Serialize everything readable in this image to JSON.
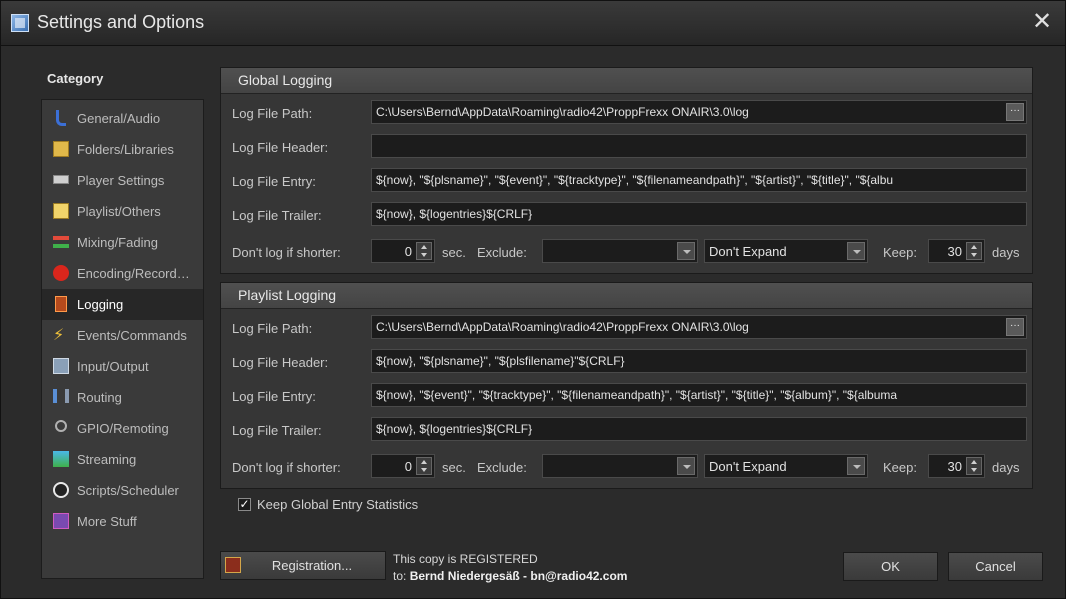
{
  "window": {
    "title": "Settings and Options",
    "close_glyph": "✕"
  },
  "sidebar": {
    "heading": "Category",
    "items": [
      {
        "label": "General/Audio",
        "icon": "music-note-icon"
      },
      {
        "label": "Folders/Libraries",
        "icon": "folder-icon"
      },
      {
        "label": "Player Settings",
        "icon": "player-icon"
      },
      {
        "label": "Playlist/Others",
        "icon": "playlist-icon"
      },
      {
        "label": "Mixing/Fading",
        "icon": "mixing-icon"
      },
      {
        "label": "Encoding/Record…",
        "icon": "record-icon"
      },
      {
        "label": "Logging",
        "icon": "log-book-icon",
        "active": true
      },
      {
        "label": "Events/Commands",
        "icon": "lightning-icon"
      },
      {
        "label": "Input/Output",
        "icon": "input-output-icon"
      },
      {
        "label": "Routing",
        "icon": "routing-icon"
      },
      {
        "label": "GPIO/Remoting",
        "icon": "gpio-icon"
      },
      {
        "label": "Streaming",
        "icon": "streaming-icon"
      },
      {
        "label": "Scripts/Scheduler",
        "icon": "clock-icon"
      },
      {
        "label": "More Stuff",
        "icon": "more-stuff-icon"
      }
    ]
  },
  "global_logging": {
    "title": "Global Logging",
    "path_label": "Log File Path:",
    "path_value": "C:\\Users\\Bernd\\AppData\\Roaming\\radio42\\ProppFrexx ONAIR\\3.0\\log",
    "browse_label": "···",
    "header_label": "Log File Header:",
    "header_value": "",
    "entry_label": "Log File Entry:",
    "entry_value": "${now}, \"${plsname}\", \"${event}\", \"${tracktype}\", \"${filenameandpath}\", \"${artist}\", \"${title}\", \"${albu",
    "trailer_label": "Log File Trailer:",
    "trailer_value": "${now}, ${logentries}${CRLF}",
    "shorter_label": "Don't log if shorter:",
    "shorter_value": "0",
    "sec_label": "sec.",
    "exclude_label": "Exclude:",
    "exclude_value": "",
    "expand_value": "Don't Expand",
    "keep_label": "Keep:",
    "keep_value": "30",
    "days_label": "days"
  },
  "playlist_logging": {
    "title": "Playlist Logging",
    "path_label": "Log File Path:",
    "path_value": "C:\\Users\\Bernd\\AppData\\Roaming\\radio42\\ProppFrexx ONAIR\\3.0\\log",
    "browse_label": "···",
    "header_label": "Log File Header:",
    "header_value": "${now}, \"${plsname}\", \"${plsfilename}\"${CRLF}",
    "entry_label": "Log File Entry:",
    "entry_value": "${now}, \"${event}\", \"${tracktype}\", \"${filenameandpath}\", \"${artist}\", \"${title}\", \"${album}\", \"${albuma",
    "trailer_label": "Log File Trailer:",
    "trailer_value": "${now}, ${logentries}${CRLF}",
    "shorter_label": "Don't log if shorter:",
    "shorter_value": "0",
    "sec_label": "sec.",
    "exclude_label": "Exclude:",
    "exclude_value": "",
    "expand_value": "Don't Expand",
    "keep_label": "Keep:",
    "keep_value": "30",
    "days_label": "days"
  },
  "options": {
    "keep_stats_label": "Keep Global Entry Statistics",
    "keep_stats_checked": true,
    "check_glyph": "✓"
  },
  "footer": {
    "registration_label": "Registration...",
    "registered_line": "This copy is REGISTERED",
    "to_prefix": "to: ",
    "registered_to": "Bernd Niedergesäß - bn@radio42.com",
    "ok_label": "OK",
    "cancel_label": "Cancel"
  }
}
